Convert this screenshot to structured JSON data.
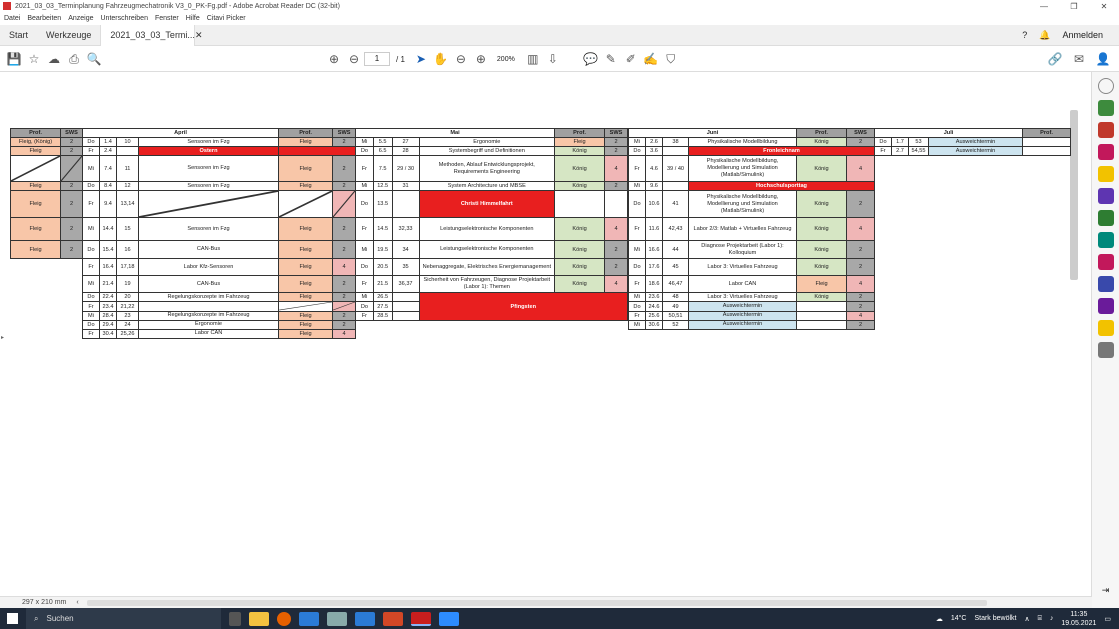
{
  "window": {
    "title": "2021_03_03_Terminplanung Fahrzeugmechatronik V3_0_PK-Fg.pdf - Adobe Acrobat Reader DC (32-bit)"
  },
  "menu": [
    "Datei",
    "Bearbeiten",
    "Anzeige",
    "Unterschreiben",
    "Fenster",
    "Hilfe",
    "Citavi Picker"
  ],
  "tabs": {
    "start": "Start",
    "tools": "Werkzeuge",
    "doc": "2021_03_03_Termi...",
    "signin": "Anmelden"
  },
  "toolbar": {
    "page_current": "1",
    "page_total": "/ 1",
    "zoom": "200%"
  },
  "status": {
    "page_size": "297 x 210 mm"
  },
  "taskbar": {
    "search": "Suchen",
    "weather_temp": "14°C",
    "weather_text": "Stark bewölkt",
    "time": "11:35",
    "date": "19.05.2021"
  },
  "headers": {
    "prof": "Prof.",
    "sws": "SWS",
    "april": "April",
    "mai": "Mai",
    "juni": "Juni",
    "juli": "Juli"
  },
  "april": [
    {
      "d": "Do",
      "dt": "1.4",
      "n": "10",
      "t": "Sensoren im Fzg",
      "p": "Fleig",
      "s": "2"
    },
    {
      "d": "Fr",
      "dt": "2.4",
      "n": "",
      "t": "Ostern",
      "p": "",
      "s": "",
      "red": true
    },
    {
      "d": "Mi",
      "dt": "7.4",
      "n": "11",
      "t": "Sensoren im Fzg",
      "p": "Fleig",
      "s": "2"
    },
    {
      "d": "Do",
      "dt": "8.4",
      "n": "12",
      "t": "Sensoren im Fzg",
      "p": "Fleig",
      "s": "2"
    },
    {
      "d": "Fr",
      "dt": "9.4",
      "n": "13,14",
      "t": "",
      "p": "",
      "s": ""
    },
    {
      "d": "Mi",
      "dt": "14.4",
      "n": "15",
      "t": "Sensoren im Fzg",
      "p": "Fleig",
      "s": "2"
    },
    {
      "d": "Do",
      "dt": "15.4",
      "n": "16",
      "t": "CAN-Bus",
      "p": "Fleig",
      "s": "2"
    },
    {
      "d": "Fr",
      "dt": "16.4",
      "n": "17,18",
      "t": "Labor Kfz-Sensoren",
      "p": "Fleig",
      "s": "4"
    },
    {
      "d": "Mi",
      "dt": "21.4",
      "n": "19",
      "t": "CAN-Bus",
      "p": "Fleig",
      "s": "2"
    },
    {
      "d": "Do",
      "dt": "22.4",
      "n": "20",
      "t": "Regelungskonzepte im Fahrzeug",
      "p": "Fleig",
      "s": "2"
    },
    {
      "d": "Fr",
      "dt": "23.4",
      "n": "21,22",
      "t": "",
      "p": "",
      "s": ""
    },
    {
      "d": "Mi",
      "dt": "28.4",
      "n": "23",
      "t": "Regelungskonzepte im Fahrzeug",
      "p": "Fleig",
      "s": "2"
    },
    {
      "d": "Do",
      "dt": "29.4",
      "n": "24",
      "t": "Ergonomie",
      "p": "Fleig",
      "s": "2"
    },
    {
      "d": "Fr",
      "dt": "30.4",
      "n": "25,26",
      "t": "Labor CAN",
      "p": "Fleig",
      "s": "4"
    }
  ],
  "pre": [
    {
      "p": "Fleig, (König)",
      "s": "2"
    },
    {
      "p": "Fleig",
      "s": "2"
    },
    {
      "p": "",
      "s": ""
    },
    {
      "p": "Fleig",
      "s": "2"
    },
    {
      "p": "Fleig",
      "s": "2"
    },
    {
      "p": "Fleig",
      "s": "2"
    },
    {
      "p": "Fleig",
      "s": "2"
    }
  ],
  "mai": [
    {
      "d": "Mi",
      "dt": "5.5",
      "n": "27",
      "t": "Ergonomie",
      "p": "Fleig",
      "s": "2"
    },
    {
      "d": "Do",
      "dt": "6.5",
      "n": "28",
      "t": "Systembegriff und Definitionen",
      "p": "König",
      "s": "2"
    },
    {
      "d": "Fr",
      "dt": "7.5",
      "n": "29 / 30",
      "t": "Methoden, Ablauf Entwicklungsprojekt, Requirements Engineering",
      "p": "König",
      "s": "4"
    },
    {
      "d": "Mi",
      "dt": "12.5",
      "n": "31",
      "t": "System Architecture und MBSE",
      "p": "König",
      "s": "2"
    },
    {
      "d": "Do",
      "dt": "13.5",
      "n": "",
      "t": "Christi Himmelfahrt",
      "p": "",
      "s": "",
      "red": true
    },
    {
      "d": "Fr",
      "dt": "14.5",
      "n": "32,33",
      "t": "Leistungselektronische Komponenten",
      "p": "König",
      "s": "4"
    },
    {
      "d": "Mi",
      "dt": "19.5",
      "n": "34",
      "t": "Leistungselektronische Komponenten",
      "p": "König",
      "s": "2"
    },
    {
      "d": "Do",
      "dt": "20.5",
      "n": "35",
      "t": "Nebenaggregate, Elektrisches Energiemanagement",
      "p": "König",
      "s": "2"
    },
    {
      "d": "Fr",
      "dt": "21.5",
      "n": "36,37",
      "t": "Sicherheit von Fahrzeugen, Diagnose Projektarbeit (Labor 1): Themen",
      "p": "König",
      "s": "4"
    },
    {
      "d": "Mi",
      "dt": "26.5",
      "n": "",
      "t": "Pfingsten",
      "p": "",
      "s": "",
      "red": true
    },
    {
      "d": "Do",
      "dt": "27.5",
      "n": "",
      "t": "",
      "p": "",
      "s": ""
    },
    {
      "d": "Fr",
      "dt": "28.5",
      "n": "",
      "t": "",
      "p": "",
      "s": ""
    }
  ],
  "juni": [
    {
      "d": "Mi",
      "dt": "2.6",
      "n": "38",
      "t": "Physikalische Modellbildung",
      "p": "König",
      "s": "2"
    },
    {
      "d": "Do",
      "dt": "3.6",
      "n": "",
      "t": "Fronleichnam",
      "p": "",
      "s": "",
      "red": true
    },
    {
      "d": "Fr",
      "dt": "4.6",
      "n": "39 / 40",
      "t": "Physikalische Modellbildung, Modellierung und Simulation (Matlab/Simulink)",
      "p": "König",
      "s": "4"
    },
    {
      "d": "Mi",
      "dt": "9.6",
      "n": "",
      "t": "Hochschulsporttag",
      "p": "",
      "s": "",
      "red": true
    },
    {
      "d": "Do",
      "dt": "10.6",
      "n": "41",
      "t": "Physikalische Modellbildung, Modellierung und Simulation (Matlab/Simulink)",
      "p": "König",
      "s": "2"
    },
    {
      "d": "Fr",
      "dt": "11.6",
      "n": "42,43",
      "t": "Labor 2/3: Matlab + Virtuelles Fahrzeug",
      "p": "König",
      "s": "4"
    },
    {
      "d": "Mi",
      "dt": "16.6",
      "n": "44",
      "t": "Diagnose Projektarbeit (Labor 1): Kolloquium",
      "p": "König",
      "s": "2"
    },
    {
      "d": "Do",
      "dt": "17.6",
      "n": "45",
      "t": "Labor 3: Virtuelles Fahrzeug",
      "p": "König",
      "s": "2"
    },
    {
      "d": "Fr",
      "dt": "18.6",
      "n": "46,47",
      "t": "Labor CAN",
      "p": "Fleig",
      "s": "4"
    },
    {
      "d": "Mi",
      "dt": "23.6",
      "n": "48",
      "t": "Labor 3: Virtuelles Fahrzeug",
      "p": "König",
      "s": "2"
    },
    {
      "d": "Do",
      "dt": "24.6",
      "n": "49",
      "t": "Ausweichtermin",
      "p": "",
      "s": "2",
      "blue": true
    },
    {
      "d": "Fr",
      "dt": "25.6",
      "n": "50,51",
      "t": "Ausweichtermin",
      "p": "",
      "s": "4",
      "blue": true
    },
    {
      "d": "Mi",
      "dt": "30.6",
      "n": "52",
      "t": "Ausweichtermin",
      "p": "",
      "s": "2",
      "blue": true
    }
  ],
  "juli": [
    {
      "d": "Do",
      "dt": "1.7",
      "n": "53",
      "t": "Ausweichtermin"
    },
    {
      "d": "Fr",
      "dt": "2.7",
      "n": "54,55",
      "t": "Ausweichtermin"
    }
  ]
}
